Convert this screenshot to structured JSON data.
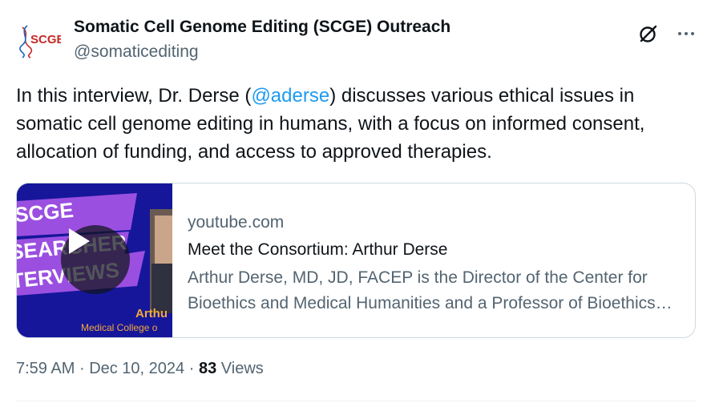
{
  "author": {
    "name": "Somatic Cell Genome Editing (SCGE) Outreach",
    "handle": "@somaticediting",
    "avatar_text": "SCGE"
  },
  "tweet": {
    "text_before": "In this interview, Dr. Derse (",
    "mention": "@aderse",
    "text_after": ") discusses various ethical issues in somatic cell genome editing in humans, with a focus on informed consent, allocation of funding, and access to approved therapies."
  },
  "card": {
    "domain": "youtube.com",
    "title": "Meet the Consortium: Arthur Derse",
    "description": "Arthur Derse, MD, JD, FACEP is the Director of the Center for Bioethics and Medical Humanities and a Professor of Bioethics and Emergency Medicine",
    "thumbnail": {
      "banner_lines": [
        "SCGE",
        "SEARCHER",
        "TERVIEWS"
      ],
      "name_text": "Arthu",
      "org_text": "Medical College o"
    }
  },
  "meta": {
    "time": "7:59 AM",
    "separator": "·",
    "date": "Dec 10, 2024",
    "views_count": "83",
    "views_label": "Views"
  },
  "icons": {
    "grok": "grok-icon",
    "more": "more-icon",
    "play": "play-icon"
  },
  "colors": {
    "mention": "#1d9bf0",
    "secondary_text": "#536471",
    "thumbnail_bg": "#16169a",
    "banner_purple": "#9b4fe0"
  }
}
